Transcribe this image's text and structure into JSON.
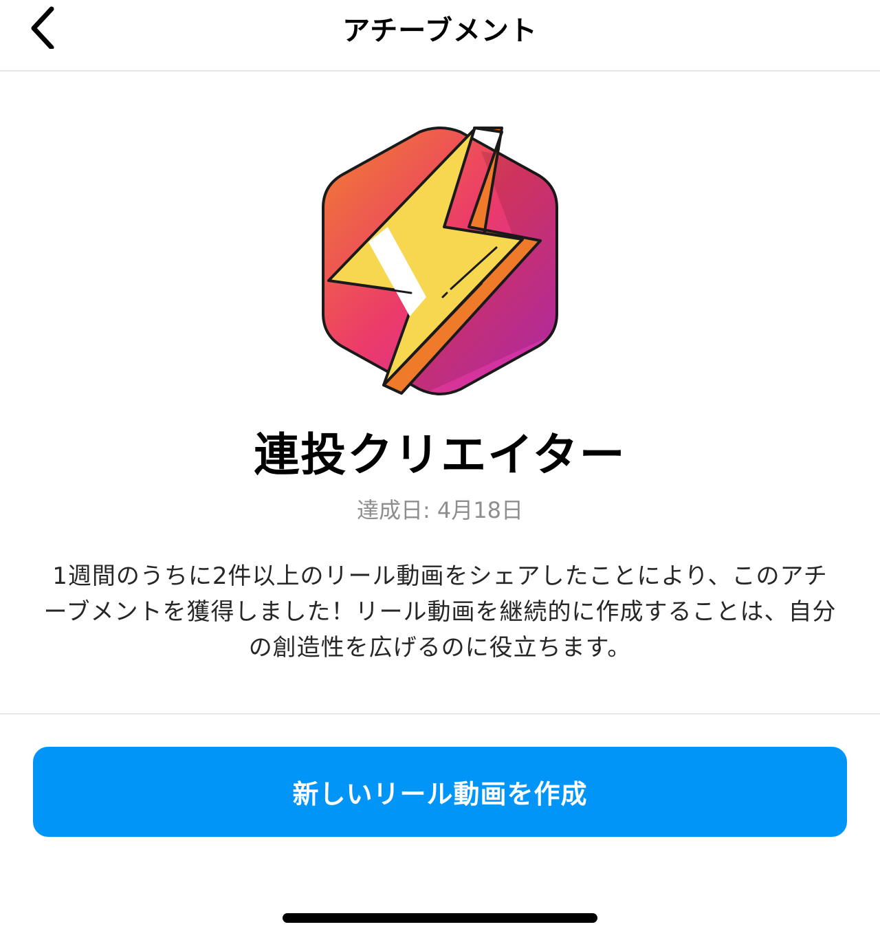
{
  "header": {
    "title": "アチーブメント",
    "back_icon": "chevron-left-icon"
  },
  "badge": {
    "icon": "lightning-bolt-hexagon-badge",
    "colors": {
      "gradient_start": "#f08030",
      "gradient_mid": "#ec3a6a",
      "gradient_end": "#c42fc0",
      "bolt": "#f7d74f",
      "bolt_side": "#ef7a2a",
      "outline": "#1a1a1a"
    }
  },
  "achievement": {
    "title": "連投クリエイター",
    "date_text": "達成日: 4月18日",
    "description": "1週間のうちに2件以上のリール動画をシェアしたことにより、このアチーブメントを獲得しました！リール動画を継続的に作成することは、自分の創造性を広げるのに役立ちます。"
  },
  "actions": {
    "primary_label": "新しいリール動画を作成",
    "primary_color": "#0095f6"
  }
}
